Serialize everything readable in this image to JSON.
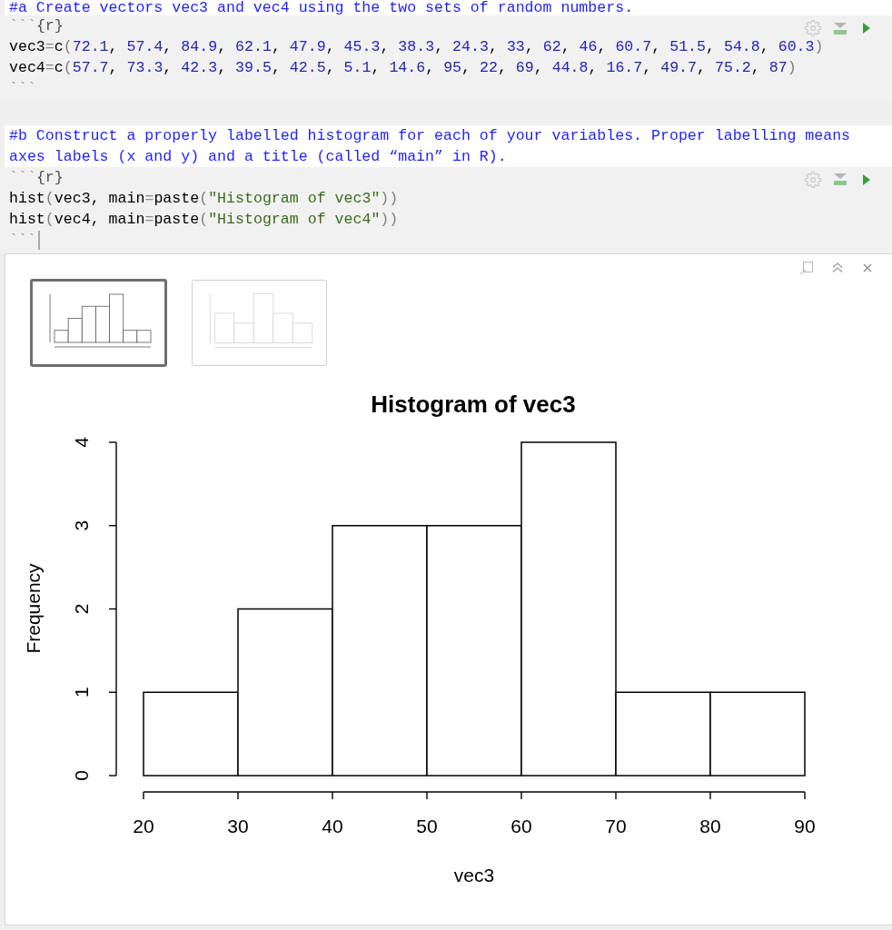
{
  "editor": {
    "blocks": [
      {
        "kind": "comment",
        "lines": [
          "#a Create vectors vec3 and vec4 using the two sets of random numbers."
        ]
      },
      {
        "kind": "chunk",
        "lines": [
          {
            "cursor": false,
            "tokens": [
              {
                "kind": "fence",
                "text": "```"
              },
              {
                "kind": "header",
                "text": "{r}"
              }
            ]
          },
          {
            "cursor": false,
            "tokens": [
              {
                "kind": "plain",
                "text": "vec3"
              },
              {
                "kind": "operator",
                "text": "="
              },
              {
                "kind": "plain",
                "text": "c"
              },
              {
                "kind": "paren",
                "text": "("
              },
              {
                "kind": "number",
                "text": "72.1"
              },
              {
                "kind": "plain",
                "text": ", "
              },
              {
                "kind": "number",
                "text": "57.4"
              },
              {
                "kind": "plain",
                "text": ", "
              },
              {
                "kind": "number",
                "text": "84.9"
              },
              {
                "kind": "plain",
                "text": ", "
              },
              {
                "kind": "number",
                "text": "62.1"
              },
              {
                "kind": "plain",
                "text": ", "
              },
              {
                "kind": "number",
                "text": "47.9"
              },
              {
                "kind": "plain",
                "text": ", "
              },
              {
                "kind": "number",
                "text": "45.3"
              },
              {
                "kind": "plain",
                "text": ", "
              },
              {
                "kind": "number",
                "text": "38.3"
              },
              {
                "kind": "plain",
                "text": ", "
              },
              {
                "kind": "number",
                "text": "24.3"
              },
              {
                "kind": "plain",
                "text": ", "
              },
              {
                "kind": "number",
                "text": "33"
              },
              {
                "kind": "plain",
                "text": ", "
              },
              {
                "kind": "number",
                "text": "62"
              },
              {
                "kind": "plain",
                "text": ", "
              },
              {
                "kind": "number",
                "text": "46"
              },
              {
                "kind": "plain",
                "text": ", "
              },
              {
                "kind": "number",
                "text": "60.7"
              },
              {
                "kind": "plain",
                "text": ", "
              },
              {
                "kind": "number",
                "text": "51.5"
              },
              {
                "kind": "plain",
                "text": ", "
              },
              {
                "kind": "number",
                "text": "54.8"
              },
              {
                "kind": "plain",
                "text": ", "
              },
              {
                "kind": "number",
                "text": "60.3"
              },
              {
                "kind": "paren",
                "text": ")"
              }
            ]
          },
          {
            "cursor": false,
            "tokens": [
              {
                "kind": "plain",
                "text": "vec4"
              },
              {
                "kind": "operator",
                "text": "="
              },
              {
                "kind": "plain",
                "text": "c"
              },
              {
                "kind": "paren",
                "text": "("
              },
              {
                "kind": "number",
                "text": "57.7"
              },
              {
                "kind": "plain",
                "text": ", "
              },
              {
                "kind": "number",
                "text": "73.3"
              },
              {
                "kind": "plain",
                "text": ", "
              },
              {
                "kind": "number",
                "text": "42.3"
              },
              {
                "kind": "plain",
                "text": ", "
              },
              {
                "kind": "number",
                "text": "39.5"
              },
              {
                "kind": "plain",
                "text": ", "
              },
              {
                "kind": "number",
                "text": "42.5"
              },
              {
                "kind": "plain",
                "text": ", "
              },
              {
                "kind": "number",
                "text": "5.1"
              },
              {
                "kind": "plain",
                "text": ", "
              },
              {
                "kind": "number",
                "text": "14.6"
              },
              {
                "kind": "plain",
                "text": ", "
              },
              {
                "kind": "number",
                "text": "95"
              },
              {
                "kind": "plain",
                "text": ", "
              },
              {
                "kind": "number",
                "text": "22"
              },
              {
                "kind": "plain",
                "text": ", "
              },
              {
                "kind": "number",
                "text": "69"
              },
              {
                "kind": "plain",
                "text": ", "
              },
              {
                "kind": "number",
                "text": "44.8"
              },
              {
                "kind": "plain",
                "text": ", "
              },
              {
                "kind": "number",
                "text": "16.7"
              },
              {
                "kind": "plain",
                "text": ", "
              },
              {
                "kind": "number",
                "text": "49.7"
              },
              {
                "kind": "plain",
                "text": ", "
              },
              {
                "kind": "number",
                "text": "75.2"
              },
              {
                "kind": "plain",
                "text": ", "
              },
              {
                "kind": "number",
                "text": "87"
              },
              {
                "kind": "paren",
                "text": ")"
              }
            ]
          },
          {
            "cursor": false,
            "tokens": [
              {
                "kind": "fence",
                "text": "```"
              }
            ]
          }
        ]
      },
      {
        "kind": "comment",
        "lines": [
          "#b Construct a properly labelled histogram for each of your variables. Proper labelling means",
          "axes labels (x and y) and a title (called “main” in R)."
        ]
      },
      {
        "kind": "chunk",
        "lines": [
          {
            "cursor": false,
            "tokens": [
              {
                "kind": "fence",
                "text": "```"
              },
              {
                "kind": "header",
                "text": "{r}"
              }
            ]
          },
          {
            "cursor": false,
            "tokens": [
              {
                "kind": "plain",
                "text": "hist"
              },
              {
                "kind": "paren",
                "text": "("
              },
              {
                "kind": "plain",
                "text": "vec3, main"
              },
              {
                "kind": "operator",
                "text": "="
              },
              {
                "kind": "plain",
                "text": "paste"
              },
              {
                "kind": "paren",
                "text": "("
              },
              {
                "kind": "string",
                "text": "\"Histogram of vec3\""
              },
              {
                "kind": "paren",
                "text": "))"
              }
            ]
          },
          {
            "cursor": false,
            "tokens": [
              {
                "kind": "plain",
                "text": "hist"
              },
              {
                "kind": "paren",
                "text": "("
              },
              {
                "kind": "plain",
                "text": "vec4, main"
              },
              {
                "kind": "operator",
                "text": "="
              },
              {
                "kind": "plain",
                "text": "paste"
              },
              {
                "kind": "paren",
                "text": "("
              },
              {
                "kind": "string",
                "text": "\"Histogram of vec4\""
              },
              {
                "kind": "paren",
                "text": "))"
              }
            ]
          },
          {
            "cursor": true,
            "tokens": [
              {
                "kind": "fence",
                "text": "```"
              }
            ]
          }
        ]
      }
    ]
  },
  "output": {
    "thumbnails": [
      {
        "selected": true
      },
      {
        "selected": false
      }
    ],
    "chart_data": {
      "type": "bar",
      "title": "Histogram of vec3",
      "xlabel": "vec3",
      "ylabel": "Frequency",
      "x": [
        25,
        35,
        45,
        55,
        65,
        75,
        85
      ],
      "values": [
        1,
        2,
        3,
        3,
        4,
        1,
        1
      ],
      "xlim": [
        20,
        90
      ],
      "ylim": [
        0,
        4
      ],
      "xticks": [
        20,
        30,
        40,
        50,
        60,
        70,
        80,
        90
      ],
      "yticks": [
        0,
        1,
        2,
        3,
        4
      ]
    }
  }
}
